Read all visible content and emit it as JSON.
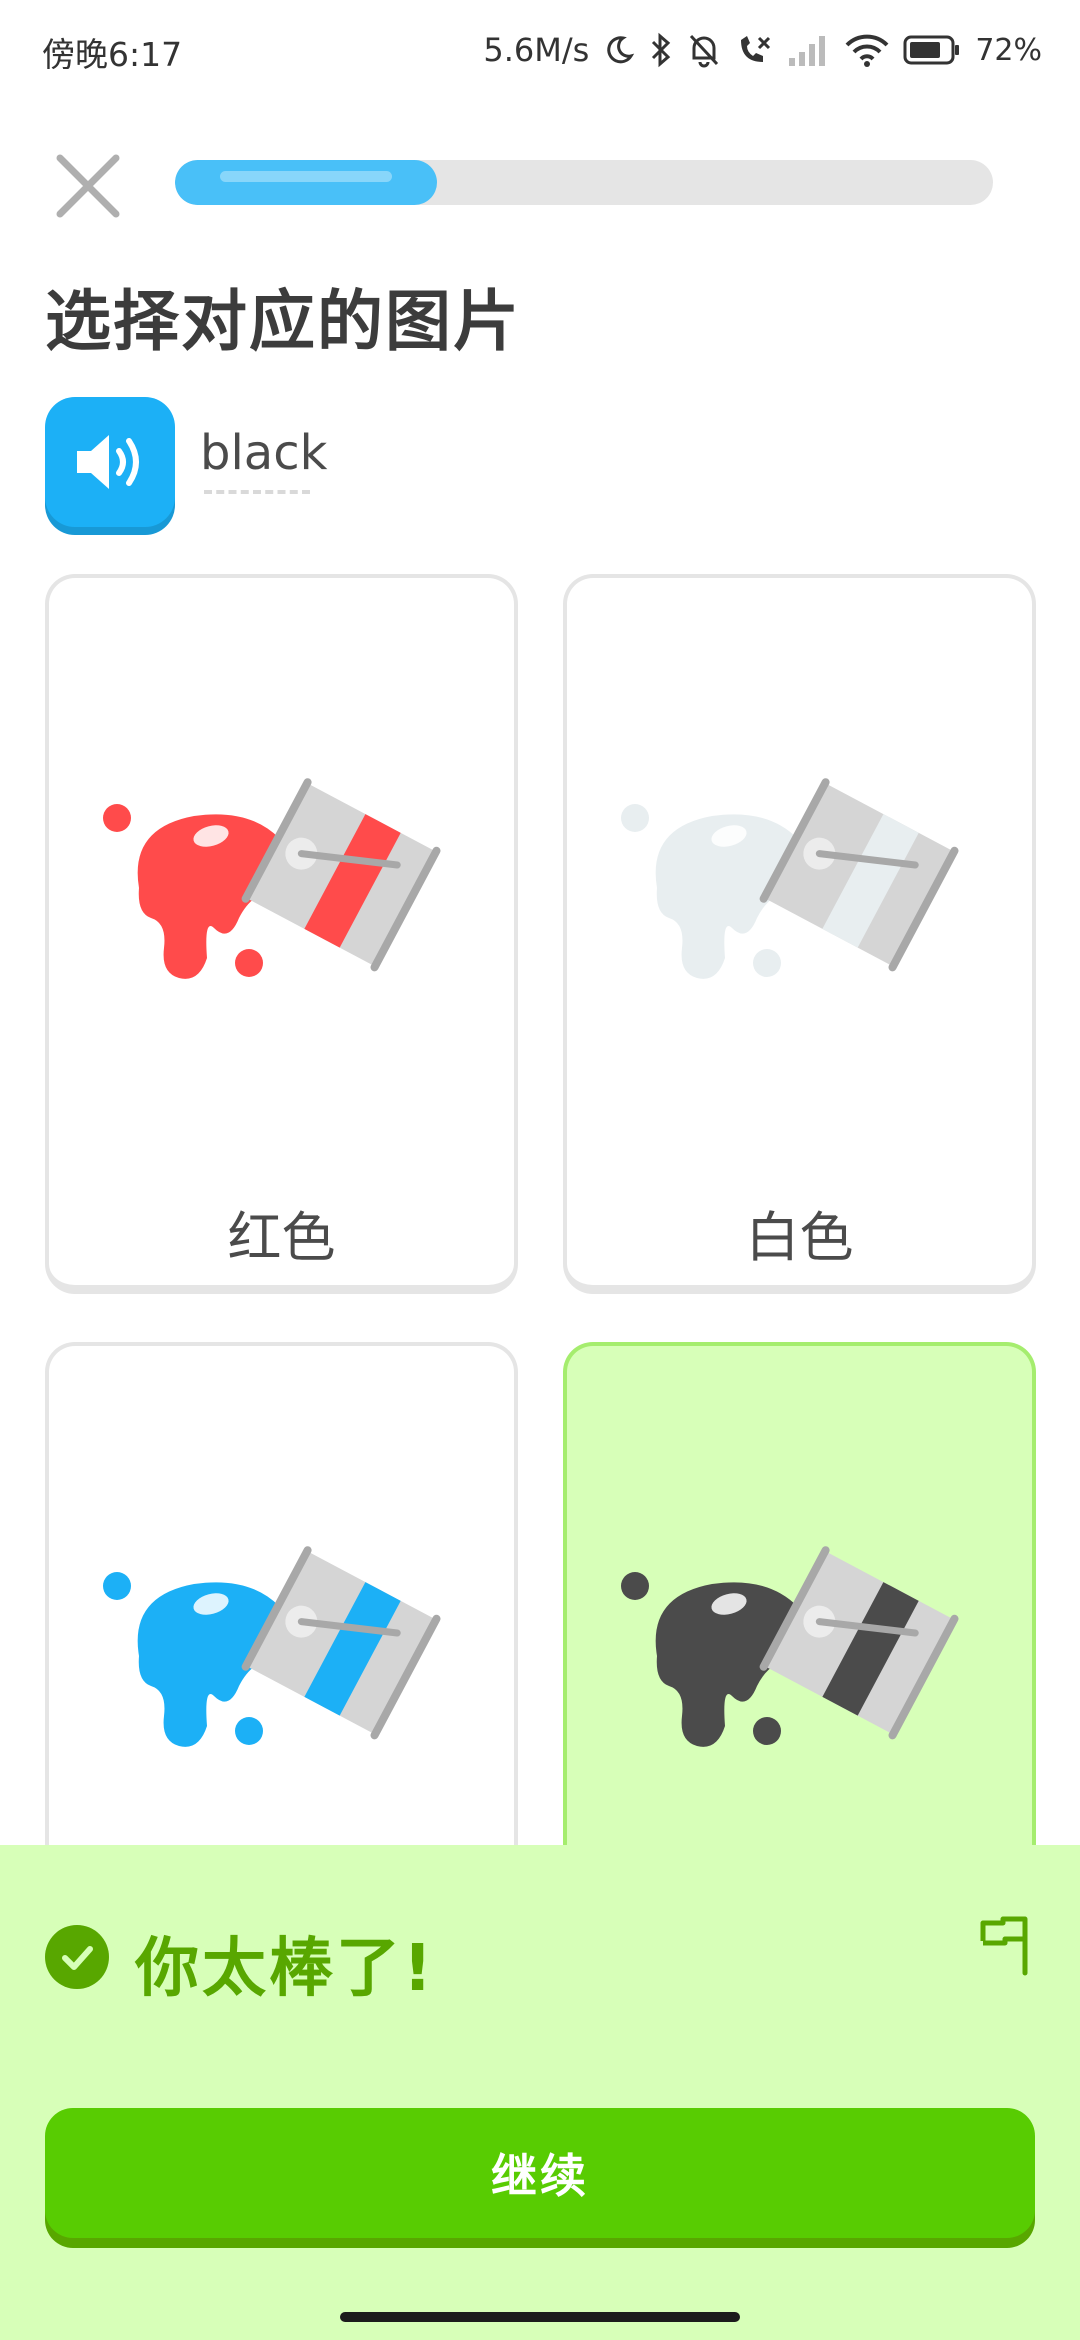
{
  "status_bar": {
    "time": "傍晚6:17",
    "net_speed": "5.6M/s",
    "battery": "72%",
    "icons": [
      "moon-icon",
      "bluetooth-icon",
      "bell-off-icon",
      "phone-missed-icon",
      "signal-icon",
      "wifi-icon",
      "battery-icon"
    ]
  },
  "header": {
    "close_icon": "close-icon",
    "progress_fraction": 0.32
  },
  "page_title": "选择对应的图片",
  "prompt": {
    "audio_icon": "speaker-icon",
    "word": "black"
  },
  "options": [
    {
      "label": "红色",
      "paint_color": "#ff4b4b",
      "selected": false
    },
    {
      "label": "白色",
      "paint_color": "#e8eef0",
      "selected": false
    },
    {
      "label": "",
      "paint_color": "#1cb0f6",
      "selected": false
    },
    {
      "label": "",
      "paint_color": "#4b4b4b",
      "selected": true
    }
  ],
  "feedback": {
    "title": "你太棒了!",
    "continue_label": "继续",
    "check_icon": "check-circle-icon",
    "report_icon": "flag-icon"
  },
  "colors": {
    "accent_blue": "#1cb0f6",
    "success_green": "#58cc02",
    "success_bg": "#d7ffb8"
  }
}
